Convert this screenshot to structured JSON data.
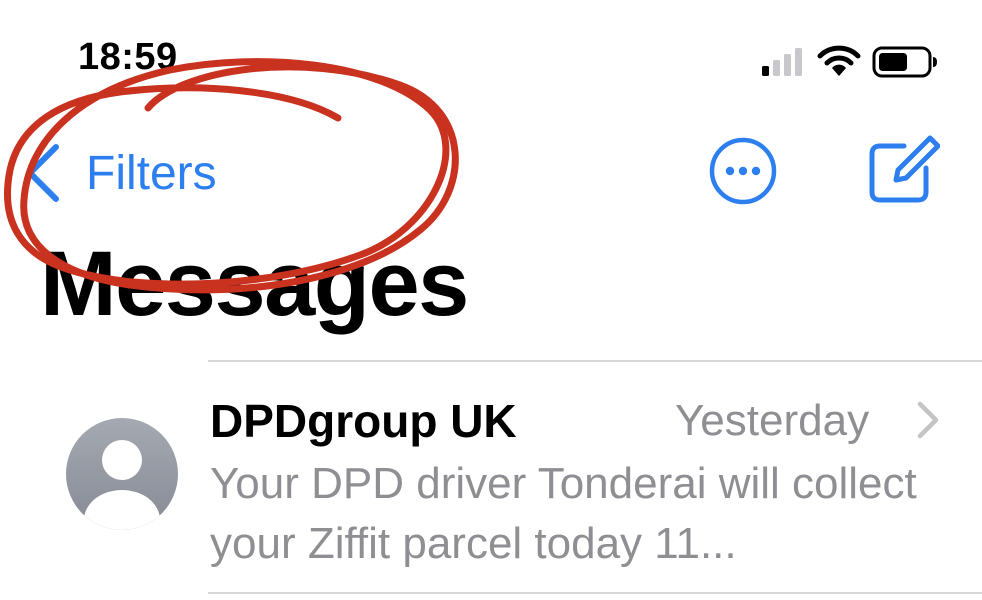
{
  "status_bar": {
    "time": "18:59",
    "signal_icon": "cellular-signal-icon",
    "wifi_icon": "wifi-icon",
    "battery_icon": "battery-icon"
  },
  "nav": {
    "back_label": "Filters",
    "back_icon": "chevron-left-icon",
    "more_icon": "ellipsis-circle-icon",
    "compose_icon": "compose-icon",
    "accent_color": "#2d7ff0"
  },
  "title": "Messages",
  "conversations": [
    {
      "sender": "DPDgroup UK",
      "timestamp": "Yesterday",
      "preview": "Your DPD driver Tonderai will collect your Ziffit parcel today 11...",
      "avatar_icon": "person-avatar-icon"
    }
  ],
  "annotation": {
    "color": "#c8321f",
    "shape": "hand-drawn-circle"
  }
}
